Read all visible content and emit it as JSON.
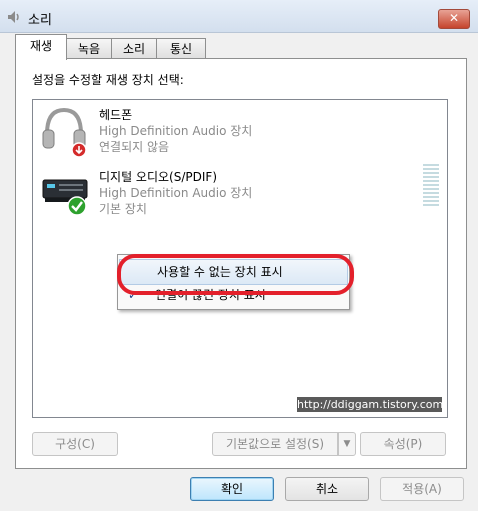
{
  "window": {
    "title": "소리",
    "close_label": "✕"
  },
  "tabs": [
    {
      "label": "재생",
      "active": true
    },
    {
      "label": "녹음",
      "active": false
    },
    {
      "label": "소리",
      "active": false
    },
    {
      "label": "통신",
      "active": false
    }
  ],
  "instruction": "설정을 수정할 재생 장치 선택:",
  "devices": [
    {
      "name": "헤드폰",
      "driver": "High Definition Audio 장치",
      "status": "연결되지 않음",
      "icon": "headphones-icon",
      "badge": "disconnected-badge-icon"
    },
    {
      "name": "디지털 오디오(S/PDIF)",
      "driver": "High Definition Audio 장치",
      "status": "기본 장치",
      "icon": "spdif-device-icon",
      "badge": "default-check-badge-icon"
    }
  ],
  "context_menu": {
    "show_disabled": "사용할 수 없는 장치 표시",
    "show_disconnected": "연결이 끊긴 장치 표시",
    "checkmark": "✓"
  },
  "watermark": "http://ddiggam.tistory.com",
  "buttons": {
    "configure": "구성(C)",
    "set_default": "기본값으로 설정(S)",
    "properties": "속성(P)",
    "ok": "확인",
    "cancel": "취소",
    "apply": "적용(A)"
  },
  "colors": {
    "highlight_ring": "#e3202b",
    "default_badge": "#2ea12e",
    "disconnected_badge": "#d42b2b"
  }
}
